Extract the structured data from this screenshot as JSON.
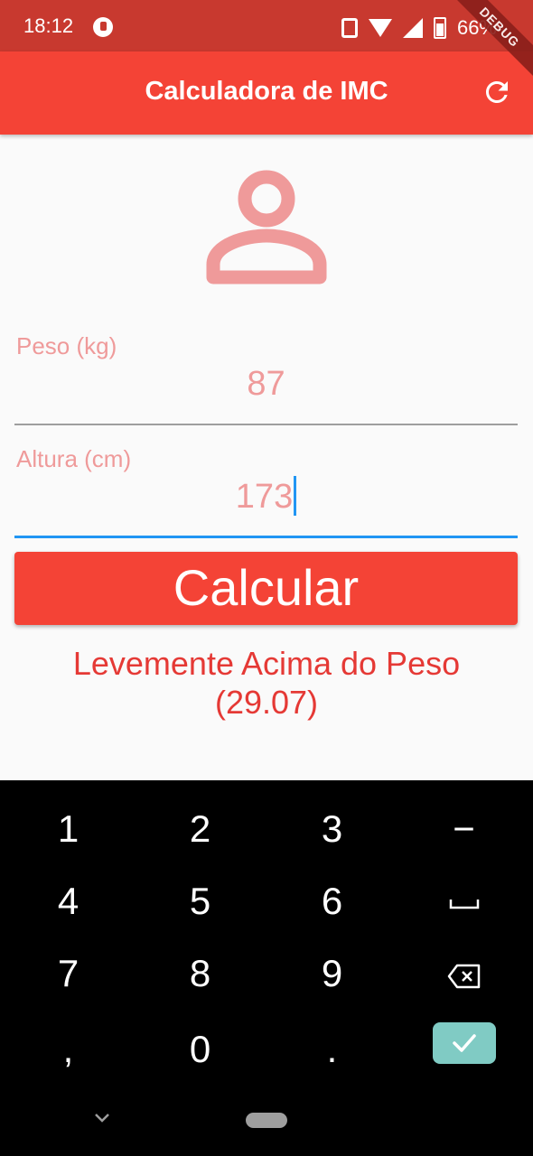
{
  "status_bar": {
    "time": "18:12",
    "battery": "66%"
  },
  "debug_banner": "DEBUG",
  "app_bar": {
    "title": "Calculadora de IMC"
  },
  "form": {
    "weight": {
      "label": "Peso (kg)",
      "value": "87"
    },
    "height": {
      "label": "Altura (cm)",
      "value": "173"
    }
  },
  "calculate_button": "Calcular",
  "result": {
    "line1": "Levemente Acima do Peso",
    "line2": "(29.07)"
  },
  "keyboard": {
    "rows": [
      [
        "1",
        "2",
        "3",
        "−"
      ],
      [
        "4",
        "5",
        "6",
        "␣"
      ],
      [
        "7",
        "8",
        "9",
        "⌫"
      ],
      [
        ",",
        "0",
        ".",
        "✓"
      ]
    ]
  },
  "colors": {
    "primary": "#f44336",
    "status_bar": "#c8392f",
    "label": "#ef9a9a",
    "focus_underline": "#2196f3",
    "result": "#e53935",
    "keyboard_bg": "#000000",
    "enter_key": "#80cbc4"
  }
}
